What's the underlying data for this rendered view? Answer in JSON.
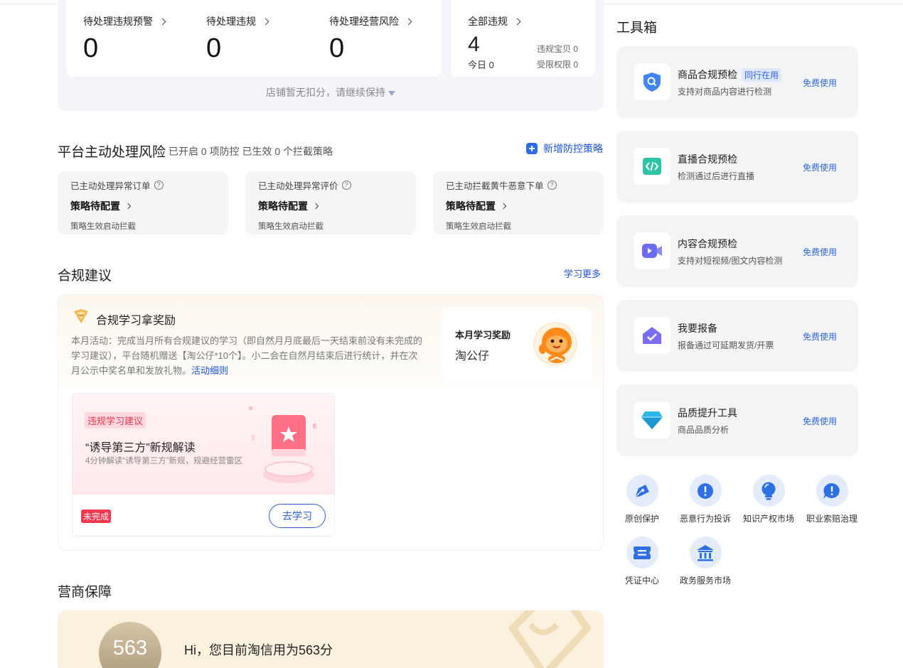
{
  "summary": {
    "stats": [
      {
        "label": "待处理违规预警",
        "value": "0"
      },
      {
        "label": "待处理违规",
        "value": "0"
      },
      {
        "label": "待处理经营风险",
        "value": "0"
      }
    ],
    "all": {
      "label": "全部违规",
      "value": "4",
      "today": "今日 0",
      "items_label": "违规宝贝 0",
      "limit_label": "受限权限 0"
    },
    "note": "店铺暂无扣分，请继续保持"
  },
  "risk": {
    "title": "平台主动处理风险",
    "subtitle": "已开启 0 项防控 已生效 0 个拦截策略",
    "add_label": "新增防控策略",
    "cards": [
      {
        "label": "已主动处理异常订单",
        "value": "策略待配置",
        "desc": "策略生效启动拦截"
      },
      {
        "label": "已主动处理异常评价",
        "value": "策略待配置",
        "desc": "策略生效启动拦截"
      },
      {
        "label": "已主动拦截黄牛恶意下单",
        "value": "策略待配置",
        "desc": "策略生效启动拦截"
      }
    ]
  },
  "advice": {
    "title": "合规建议",
    "more": "学习更多",
    "head_title": "合规学习拿奖励",
    "head_text": "本月活动：完成当月所有合规建议的学习（即自然月月底最后一天结束前没有未完成的学习建议），平台随机赠送【淘公仔*10个】。小二会在自然月结束后进行统计，并在次月公示中奖名单和发放礼物。",
    "head_link": "活动细则",
    "reward_label": "本月学习奖励",
    "reward_item": "淘公仔",
    "lesson": {
      "tag": "违规学习建议",
      "title": "“诱导第三方”新规解读",
      "desc": "4分钟解读“诱导第三方”新规，规避经营雷区",
      "status": "未完成",
      "button": "去学习"
    }
  },
  "guard": {
    "title": "营商保障",
    "score": "563",
    "message": "Hi，您目前淘信用为563分"
  },
  "toolbox": {
    "title": "工具箱",
    "tools": [
      {
        "name": "商品合规预检",
        "tag": "同行在用",
        "desc": "支持对商品内容进行检测",
        "action": "免费使用",
        "icon": "shield-search-icon"
      },
      {
        "name": "直播合规预检",
        "tag": "",
        "desc": "检测通过后进行直播",
        "action": "免费使用",
        "icon": "code-icon"
      },
      {
        "name": "内容合规预检",
        "tag": "",
        "desc": "支持对短视频/图文内容检测",
        "action": "免费使用",
        "icon": "video-camera-icon"
      },
      {
        "name": "我要报备",
        "tag": "",
        "desc": "报备通过可延期发货/开票",
        "action": "免费使用",
        "icon": "house-check-icon"
      },
      {
        "name": "品质提升工具",
        "tag": "",
        "desc": "商品品质分析",
        "action": "免费使用",
        "icon": "diamond-icon"
      }
    ],
    "quick": [
      {
        "label": "原创保护",
        "icon": "pen-nib-icon"
      },
      {
        "label": "恶意行为投诉",
        "icon": "alert-icon"
      },
      {
        "label": "知识产权市场",
        "icon": "bulb-icon"
      },
      {
        "label": "职业索赔治理",
        "icon": "alert-chat-icon"
      },
      {
        "label": "凭证中心",
        "icon": "voucher-icon"
      },
      {
        "label": "政务服务市场",
        "icon": "government-icon"
      }
    ]
  },
  "colors": {
    "accent": "#1a52d6",
    "danger": "#f0384f",
    "card_bg": "#f3f4f6",
    "summary_bg": "#f3f5fb"
  }
}
